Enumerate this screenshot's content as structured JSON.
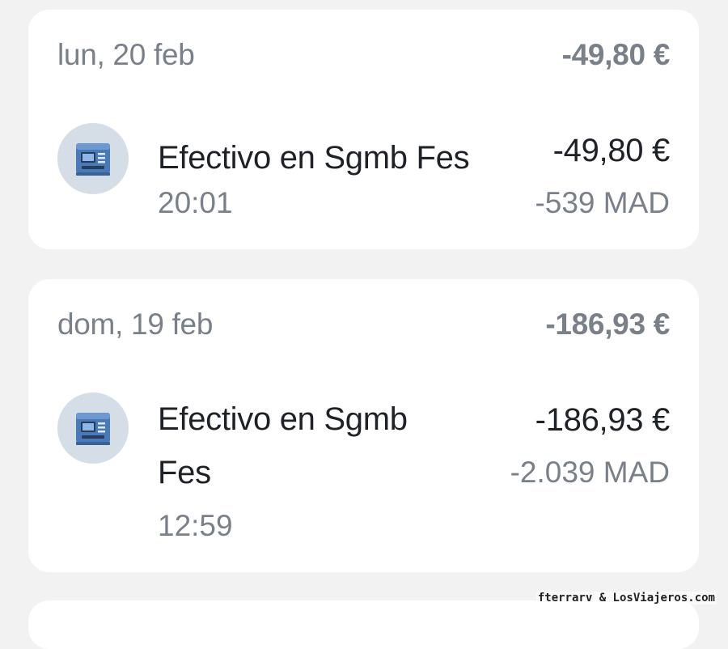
{
  "days": [
    {
      "date": "lun, 20 feb",
      "total": "-49,80 €",
      "transactions": [
        {
          "name": "Efectivo en Sgmb Fes",
          "time": "20:01",
          "amount": "-49,80 €",
          "local_amount": "-539 MAD",
          "icon": "atm-machine-icon"
        }
      ]
    },
    {
      "date": "dom, 19 feb",
      "total": "-186,93 €",
      "transactions": [
        {
          "name": "Efectivo en Sgmb Fes",
          "time": "12:59",
          "amount": "-186,93 €",
          "local_amount": "-2.039 MAD",
          "icon": "atm-machine-icon"
        }
      ]
    }
  ],
  "watermark": "fterrarv & LosViajeros.com",
  "colors": {
    "background": "#f2f2f3",
    "card": "#ffffff",
    "primary_text": "#1e2126",
    "secondary_text": "#7a8089",
    "icon_circle": "#d5dde6",
    "atm_blue": "#4a79b8"
  }
}
